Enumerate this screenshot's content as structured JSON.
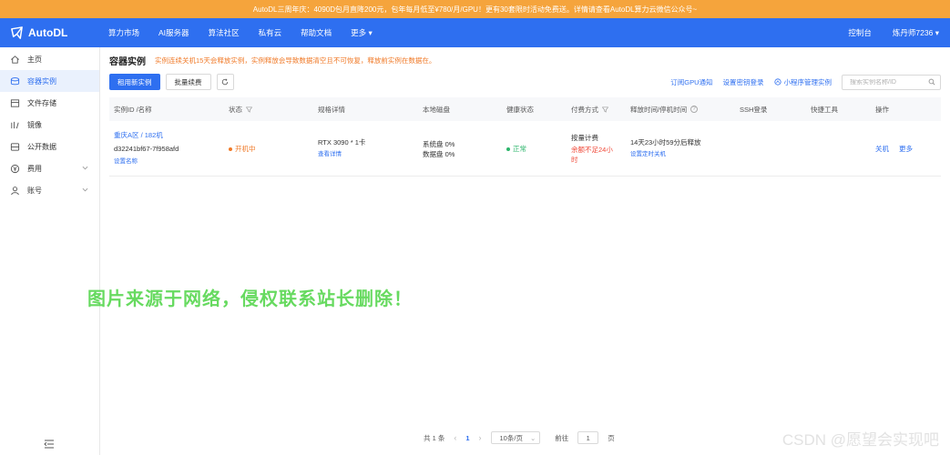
{
  "banner": {
    "text": "AutoDL三周年庆：4090D包月直降200元，包年每月低至¥780/月/GPU！更有30套限时活动免费送。详情请查看AutoDL算力云微信公众号~"
  },
  "brand": {
    "name": "AutoDL",
    "color": "#2e6ff0"
  },
  "topnav": {
    "items": [
      "算力市场",
      "AI服务器",
      "算法社区",
      "私有云",
      "帮助文档",
      "更多"
    ],
    "console": "控制台",
    "user": "炼丹师7236"
  },
  "sidebar": {
    "items": [
      {
        "label": "主页",
        "icon": "home-icon"
      },
      {
        "label": "容器实例",
        "icon": "container-icon",
        "active": true
      },
      {
        "label": "文件存储",
        "icon": "storage-icon"
      },
      {
        "label": "镜像",
        "icon": "image-icon"
      },
      {
        "label": "公开数据",
        "icon": "database-icon"
      },
      {
        "label": "费用",
        "icon": "yen-icon",
        "expandable": true
      },
      {
        "label": "账号",
        "icon": "user-icon",
        "expandable": true
      }
    ]
  },
  "page": {
    "title": "容器实例",
    "note": "实例连续关机15天会释放实例，实例释放会导致数据清空且不可恢复，释放前实例在数据在。"
  },
  "toolbar": {
    "rent_label": "租用新实例",
    "renew_label": "批量续费",
    "subscribe_gpu": "订阅GPU通知",
    "set_key_login": "设置密钥登录",
    "mini_program": "小程序管理实例",
    "search_placeholder": "搜索实例名称/ID"
  },
  "table": {
    "headers": [
      "实例ID /名称",
      "状态",
      "规格详情",
      "本地磁盘",
      "健康状态",
      "付费方式",
      "释放时间/停机时间",
      "SSH登录",
      "快捷工具",
      "操作"
    ],
    "rows": [
      {
        "region": "重庆A区 / 182机",
        "id": "d32241bf67-7f958afd",
        "set_name": "设置名称",
        "status": "开机中",
        "spec": "RTX 3090 * 1卡",
        "spec_detail": "查看详情",
        "disk_system": "系统盘 0%",
        "disk_data": "数据盘 0%",
        "health": "正常",
        "pay_type": "按量计费",
        "pay_warning": "余额不足24小时",
        "release": "14天23小时59分后释放",
        "set_shutdown": "设置定时关机",
        "action_shutdown": "关机",
        "action_more": "更多"
      }
    ]
  },
  "pagination": {
    "total": "共 1 条",
    "current": "1",
    "page_size": "10条/页",
    "goto_prefix": "前往",
    "goto_value": "1",
    "goto_suffix": "页"
  },
  "watermarks": {
    "center": "图片来源于网络，侵权联系站长删除！",
    "csdn": "CSDN @愿望会实现吧"
  }
}
